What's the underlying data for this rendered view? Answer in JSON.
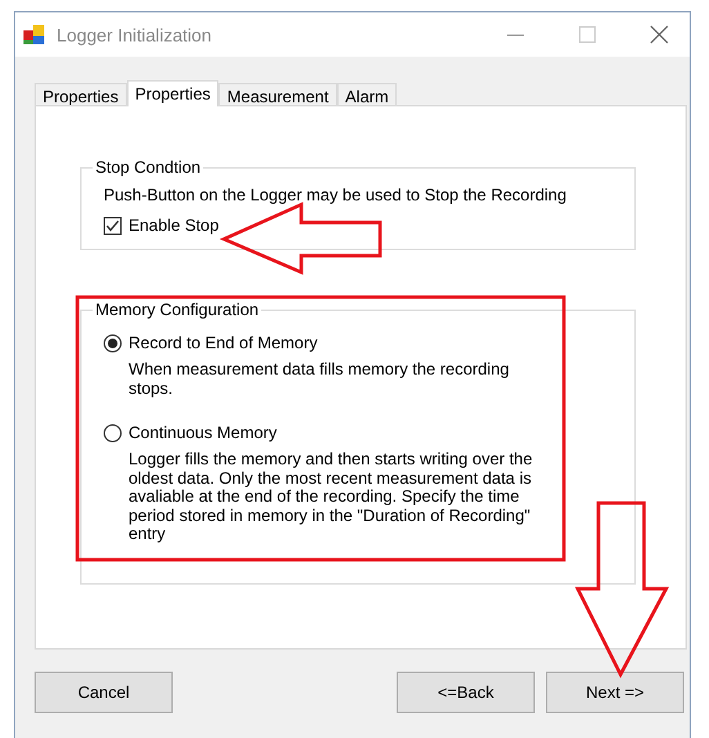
{
  "window": {
    "title": "Logger Initialization"
  },
  "tabs": [
    {
      "label": "Properties",
      "selected": false
    },
    {
      "label": "Properties",
      "selected": true
    },
    {
      "label": "Measurement",
      "selected": false
    },
    {
      "label": "Alarm",
      "selected": false
    }
  ],
  "stop_condition": {
    "title": "Stop Condtion",
    "description": "Push-Button on the Logger may be used to Stop the Recording",
    "checkbox": {
      "label": "Enable Stop",
      "checked": true
    }
  },
  "memory_configuration": {
    "title": "Memory Configuration",
    "options": [
      {
        "label": "Record to End of Memory",
        "selected": true,
        "description": "When measurement data fills memory the recording stops."
      },
      {
        "label": "Continuous Memory",
        "selected": false,
        "description": "Logger fills the memory and then starts writing over the oldest data. Only the most recent measurement data is avaliable at the end of the recording. Specify the time period stored in memory in the \"Duration of Recording\" entry"
      }
    ]
  },
  "buttons": [
    {
      "label": "Cancel"
    },
    {
      "label": "<=Back"
    },
    {
      "label": "Next =>"
    }
  ],
  "annotations": [
    {
      "kind": "left-arrow"
    },
    {
      "kind": "frame"
    },
    {
      "kind": "down-arrow"
    }
  ]
}
